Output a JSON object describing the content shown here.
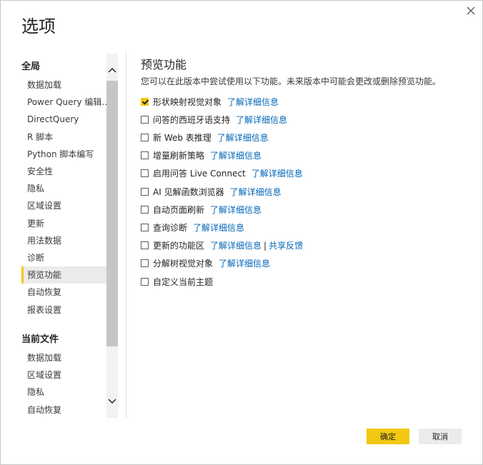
{
  "dialog": {
    "title": "选项"
  },
  "sidebar": {
    "global_title": "全局",
    "global_items": [
      {
        "label": "数据加载"
      },
      {
        "label": "Power Query 编辑..."
      },
      {
        "label": "DirectQuery"
      },
      {
        "label": "R 脚本"
      },
      {
        "label": "Python 脚本编写"
      },
      {
        "label": "安全性"
      },
      {
        "label": "隐私"
      },
      {
        "label": "区域设置"
      },
      {
        "label": "更新"
      },
      {
        "label": "用法数据"
      },
      {
        "label": "诊断"
      },
      {
        "label": "预览功能",
        "active": true
      },
      {
        "label": "自动恢复"
      },
      {
        "label": "报表设置"
      }
    ],
    "file_title": "当前文件",
    "file_items": [
      {
        "label": "数据加载"
      },
      {
        "label": "区域设置"
      },
      {
        "label": "隐私"
      },
      {
        "label": "自动恢复"
      }
    ]
  },
  "main": {
    "heading": "预览功能",
    "description": "您可以在此版本中尝试使用以下功能。未来版本中可能会更改或删除预览功能。",
    "features": [
      {
        "label": "形状映射视觉对象",
        "checked": true,
        "link": "了解详细信息"
      },
      {
        "label": "问答的西班牙语支持",
        "checked": false,
        "link": "了解详细信息"
      },
      {
        "label": "新 Web 表推理",
        "checked": false,
        "link": "了解详细信息"
      },
      {
        "label": "增量刷新策略",
        "checked": false,
        "link": "了解详细信息"
      },
      {
        "label": "启用问答 Live Connect",
        "checked": false,
        "link": "了解详细信息"
      },
      {
        "label": "AI 见解函数浏览器",
        "checked": false,
        "link": "了解详细信息"
      },
      {
        "label": "自动页面刷新",
        "checked": false,
        "link": "了解详细信息"
      },
      {
        "label": "查询诊断",
        "checked": false,
        "link": "了解详细信息"
      },
      {
        "label": "更新的功能区",
        "checked": false,
        "link": "了解详细信息",
        "separator": "|",
        "link2": "共享反馈"
      },
      {
        "label": "分解树视觉对象",
        "checked": false,
        "link": "了解详细信息"
      },
      {
        "label": "自定义当前主题",
        "checked": false
      }
    ]
  },
  "footer": {
    "ok_label": "确定",
    "cancel_label": "取消"
  },
  "colors": {
    "accent": "#f2c811",
    "link": "#0066b8",
    "active_bg": "#edebe9"
  }
}
